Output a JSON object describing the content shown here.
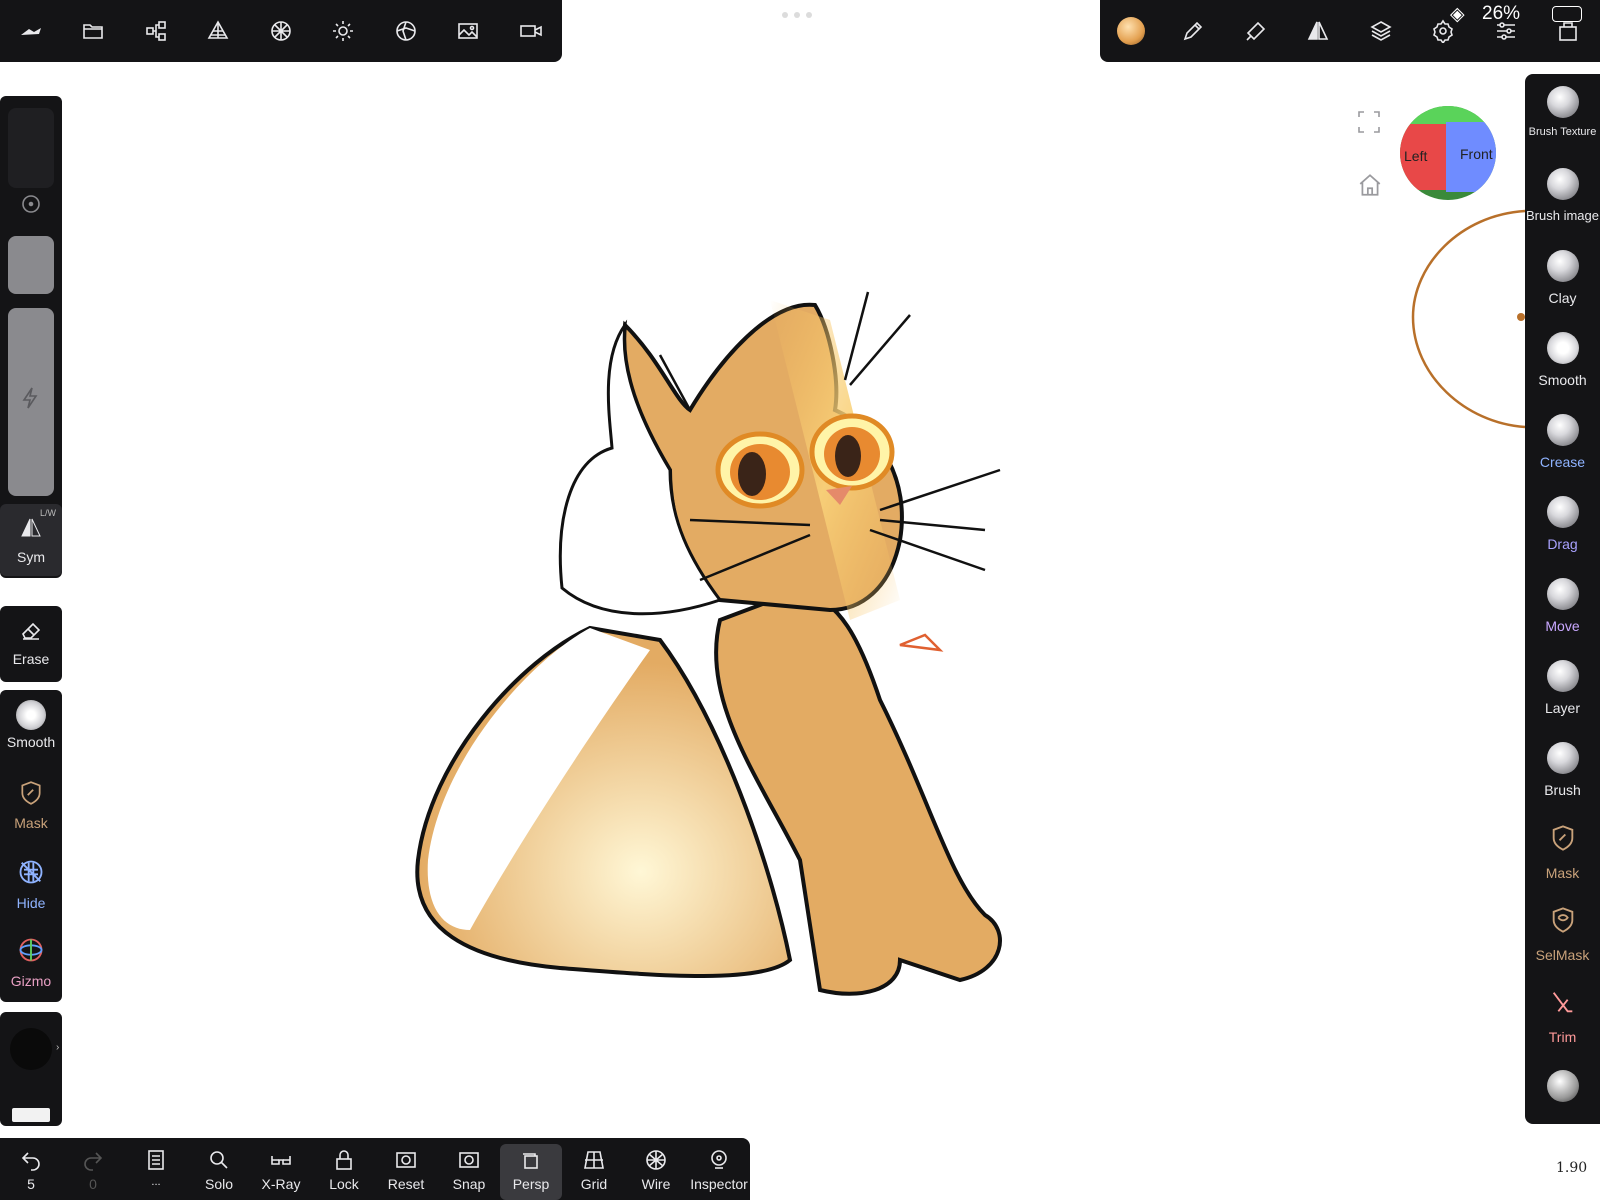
{
  "top_toolbar": {
    "left_icons": [
      "nomad-logo-icon",
      "folder-icon",
      "scene-graph-icon",
      "topology-icon",
      "material-sphere-icon",
      "light-icon",
      "shading-icon",
      "background-image-icon",
      "camera-icon"
    ],
    "right_icons": [
      "material-preview-icon",
      "paint-brush-icon",
      "paint-tool-icon",
      "symmetry-icon",
      "layers-icon",
      "settings-icon",
      "sliders-icon",
      "interface-icon"
    ]
  },
  "status_bar": {
    "battery_text": "26%"
  },
  "left_panel": {
    "sym_label": "Sym",
    "sym_badge": "L/W",
    "erase_label": "Erase",
    "tools": [
      {
        "label": "Smooth",
        "color": "#e9e9ec"
      },
      {
        "label": "Mask",
        "color": "#c9a27a"
      },
      {
        "label": "Hide",
        "color": "#8fb3ff"
      },
      {
        "label": "Gizmo",
        "color": "#e9a0c4"
      }
    ]
  },
  "brush_panel": {
    "items": [
      {
        "label": "Brush Texture",
        "color": "#e9e9ec"
      },
      {
        "label": "Brush image",
        "color": "#e9e9ec"
      },
      {
        "label": "Clay",
        "color": "#e9e9ec"
      },
      {
        "label": "Smooth",
        "color": "#e9e9ec"
      },
      {
        "label": "Crease",
        "color": "#8fb3ff"
      },
      {
        "label": "Drag",
        "color": "#a9a2ff"
      },
      {
        "label": "Move",
        "color": "#c9a8ff"
      },
      {
        "label": "Layer",
        "color": "#e9e9ec"
      },
      {
        "label": "Brush",
        "color": "#e9e9ec"
      },
      {
        "label": "Mask",
        "color": "#c9a27a"
      },
      {
        "label": "SelMask",
        "color": "#c9a27a"
      },
      {
        "label": "Trim",
        "color": "#ff9a9a"
      }
    ]
  },
  "view_cube": {
    "left_label": "Left",
    "front_label": "Front"
  },
  "bottom_bar": {
    "undo_count": "5",
    "redo_count": "0",
    "buttons": [
      {
        "label": "Solo"
      },
      {
        "label": "X-Ray"
      },
      {
        "label": "Lock"
      },
      {
        "label": "Reset"
      },
      {
        "label": "Snap"
      },
      {
        "label": "Persp",
        "active": true
      },
      {
        "label": "Grid"
      },
      {
        "label": "Wire"
      },
      {
        "label": "Inspector"
      }
    ],
    "more_label": "..."
  },
  "zoom_readout": "1.90",
  "colors": {
    "brush_ring": "#b8702a",
    "cat_fill": "#e3ab63"
  }
}
